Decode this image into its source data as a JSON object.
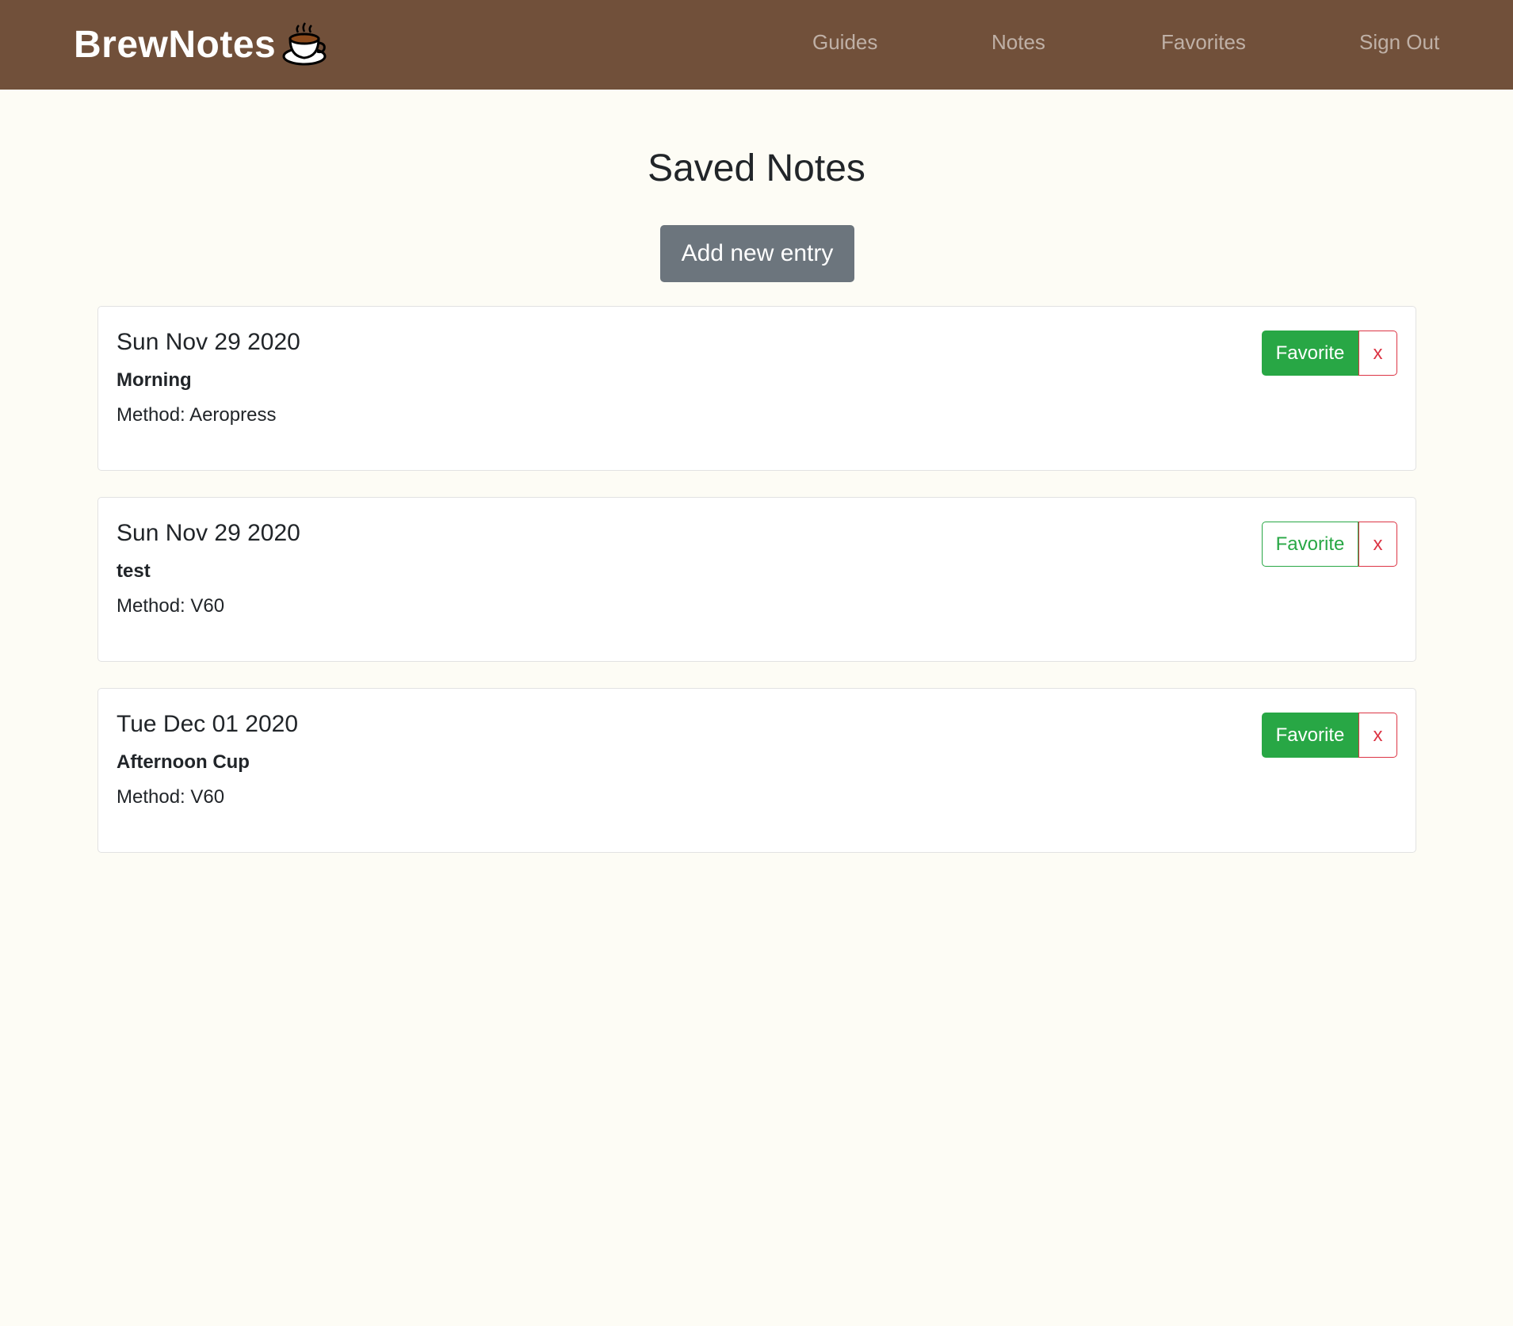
{
  "navbar": {
    "brand": "BrewNotes",
    "brand_icon": "coffee-cup-icon",
    "links": [
      "Guides",
      "Notes",
      "Favorites",
      "Sign Out"
    ]
  },
  "page": {
    "title": "Saved Notes",
    "add_button": "Add new entry"
  },
  "notes": [
    {
      "date": "Sun Nov 29 2020",
      "name": "Morning",
      "method": "Method: Aeropress",
      "favorite_label": "Favorite",
      "favorited": true,
      "delete_label": "x"
    },
    {
      "date": "Sun Nov 29 2020",
      "name": "test",
      "method": "Method: V60",
      "favorite_label": "Favorite",
      "favorited": false,
      "delete_label": "x"
    },
    {
      "date": "Tue Dec 01 2020",
      "name": "Afternoon Cup",
      "method": "Method: V60",
      "favorite_label": "Favorite",
      "favorited": true,
      "delete_label": "x"
    }
  ],
  "colors": {
    "navbar": "#71503a",
    "background": "#fdfcf5",
    "success": "#28a745",
    "danger": "#dc3545",
    "secondary": "#6c757d"
  }
}
